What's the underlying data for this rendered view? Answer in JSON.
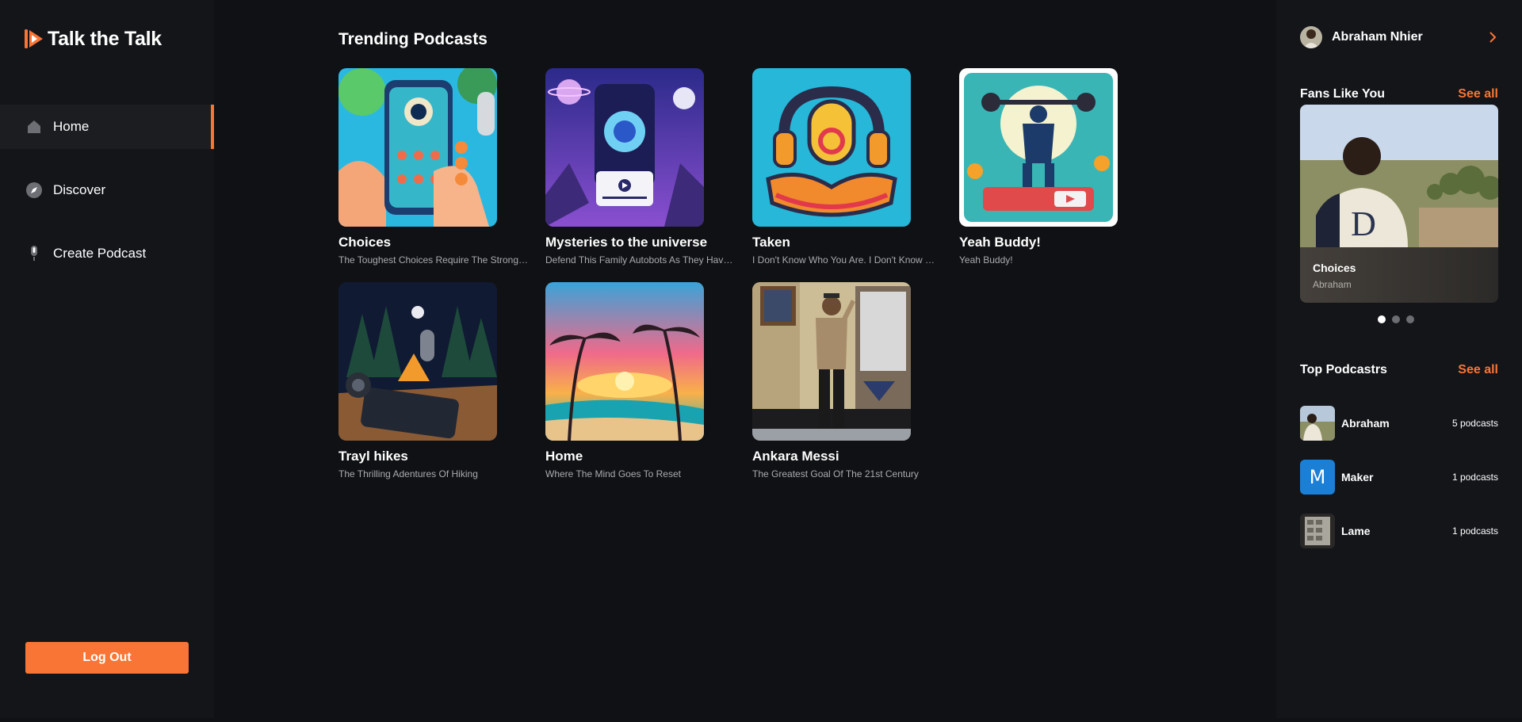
{
  "brand": {
    "name": "Talk the Talk",
    "accent": "#f97535"
  },
  "nav": [
    {
      "label": "Home",
      "icon": "home-icon",
      "active": true
    },
    {
      "label": "Discover",
      "icon": "compass-icon",
      "active": false
    },
    {
      "label": "Create Podcast",
      "icon": "microphone-icon",
      "active": false
    }
  ],
  "logout_label": "Log Out",
  "main": {
    "section_title": "Trending Podcasts",
    "podcasts": [
      {
        "title": "Choices",
        "description": "The Toughest Choices Require The Strongest Wills"
      },
      {
        "title": "Mysteries to the universe",
        "description": "Defend This Family Autobots As They Have Defended You"
      },
      {
        "title": "Taken",
        "description": "I Don't Know Who You Are. I Don't Know What You Want"
      },
      {
        "title": "Yeah Buddy!",
        "description": "Yeah Buddy!"
      },
      {
        "title": "Trayl hikes",
        "description": "The Thrilling Adentures Of Hiking"
      },
      {
        "title": "Home",
        "description": "Where The Mind Goes To Reset"
      },
      {
        "title": "Ankara Messi",
        "description": "The Greatest Goal Of The 21st Century"
      }
    ]
  },
  "right": {
    "profile_name": "Abraham Nhier",
    "fans": {
      "title": "Fans Like You",
      "see_all": "See all",
      "card_title": "Choices",
      "card_author": "Abraham",
      "slides": 3,
      "active_slide": 1
    },
    "top": {
      "title": "Top Podcastrs",
      "see_all": "See all",
      "items": [
        {
          "name": "Abraham",
          "count": "5 podcasts"
        },
        {
          "name": "Maker",
          "count": "1 podcasts",
          "initial": "M"
        },
        {
          "name": "Lame",
          "count": "1 podcasts"
        }
      ]
    }
  }
}
